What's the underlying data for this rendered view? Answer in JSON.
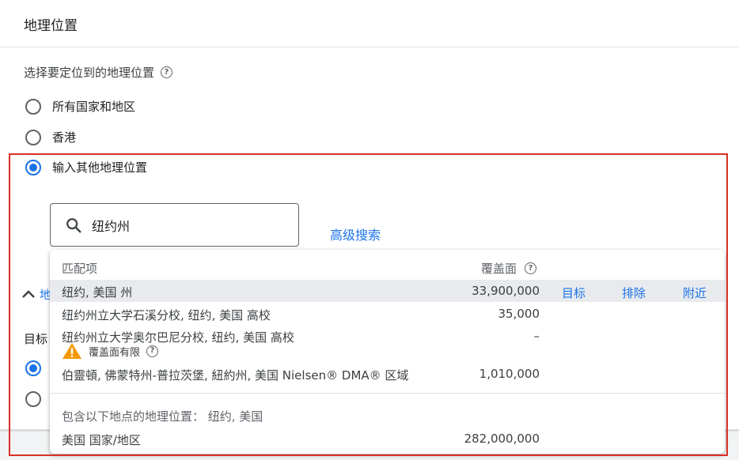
{
  "card": {
    "title": "地理位置",
    "section_label": "选择要定位到的地理位置",
    "options": [
      {
        "label": "所有国家和地区",
        "selected": false
      },
      {
        "label": "香港",
        "selected": false
      },
      {
        "label": "输入其他地理位置",
        "selected": true
      }
    ]
  },
  "search": {
    "value": "纽约州",
    "advanced_label": "高级搜索"
  },
  "obscured": {
    "collapse_text": "地",
    "target_text": "目标"
  },
  "dropdown": {
    "header_match": "匹配项",
    "header_coverage": "覆盖面",
    "rows": [
      {
        "name": "纽约, 美国 州",
        "reach": "33,900,000",
        "target": "目标",
        "exclude": "排除",
        "nearby": "附近"
      },
      {
        "name": "纽约州立大学石溪分校, 纽约, 美国 高校",
        "reach": "35,000"
      },
      {
        "name": "纽约州立大学奥尔巴尼分校, 纽约, 美国 高校",
        "reach": "–"
      },
      {
        "name": "伯靈頓, 佛蒙特州-普拉茨堡, 紐約州, 美国 Nielsen® DMA® 区域",
        "reach": "1,010,000"
      }
    ],
    "warning_text": "覆盖面有限",
    "contains_label": "包含以下地点的地理位置： 纽约, 美国",
    "contains_rows": [
      {
        "name": "美国 国家/地区",
        "reach": "282,000,000"
      }
    ]
  },
  "colors": {
    "accent": "#1a73e8",
    "highlight_border": "#d93025",
    "warning": "#f29900"
  }
}
